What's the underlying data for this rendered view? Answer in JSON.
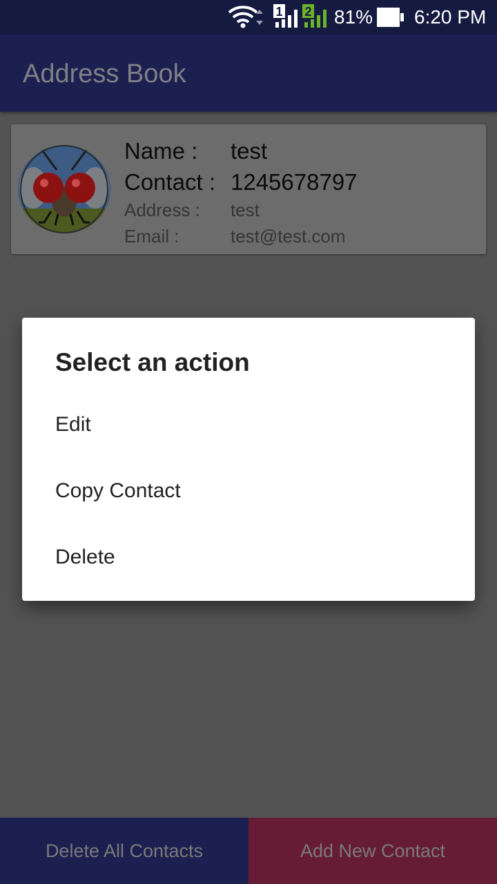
{
  "status_bar": {
    "sim1_label": "1",
    "sim2_label": "2",
    "battery_percent": "81%",
    "time": "6:20 PM",
    "icons": [
      "wifi-icon",
      "sim1-signal-icon",
      "sim2-signal-icon",
      "battery-icon"
    ]
  },
  "app_bar": {
    "title": "Address Book"
  },
  "contact": {
    "name_label": "Name :",
    "name": "test",
    "contact_label": "Contact :",
    "contact": "1245678797",
    "address_label": "Address :",
    "address": "test",
    "email_label": "Email :",
    "email": "test@test.com"
  },
  "dialog": {
    "title": "Select an action",
    "items": [
      {
        "label": "Edit"
      },
      {
        "label": "Copy Contact"
      },
      {
        "label": "Delete"
      }
    ]
  },
  "bottom_bar": {
    "delete_all_label": "Delete All Contacts",
    "add_new_label": "Add New Contact"
  },
  "colors": {
    "primary": "#1c2050",
    "accent": "#661c35",
    "scrim": "#535353",
    "dialog_bg": "#ffffff"
  }
}
